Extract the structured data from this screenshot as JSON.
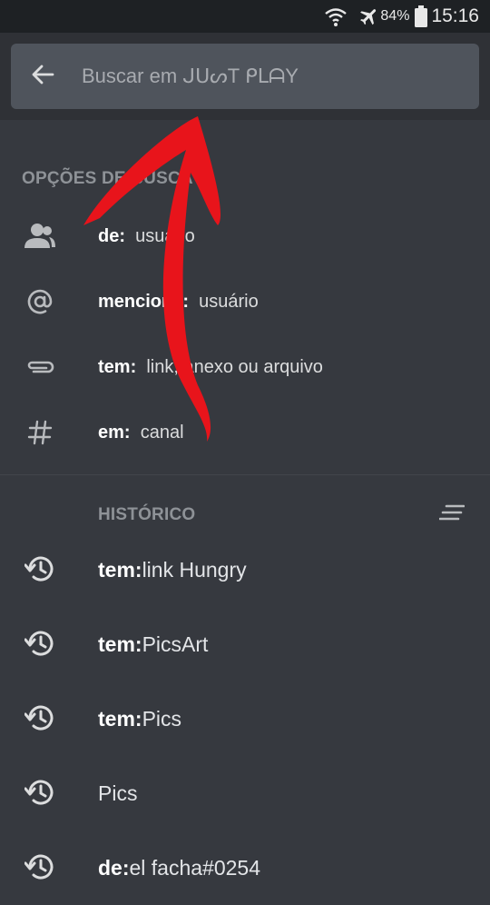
{
  "status_bar": {
    "battery": "84%",
    "time": "15:16",
    "icons": [
      "wifi-icon",
      "airplane-icon",
      "battery-icon"
    ]
  },
  "search": {
    "placeholder": "Buscar em ᒍᑌᔕT ᑭᒪᗩY",
    "back_icon": "arrow-left-icon"
  },
  "options_section": {
    "title": "OPÇÕES DE BUSCA",
    "items": [
      {
        "icon": "user-icon",
        "key": "de:",
        "value": "usuário"
      },
      {
        "icon": "at-icon",
        "key": "menciona:",
        "value": "usuário"
      },
      {
        "icon": "paperclip-icon",
        "key": "tem:",
        "value": "link, anexo ou arquivo"
      },
      {
        "icon": "hash-icon",
        "key": "em:",
        "value": "canal"
      }
    ]
  },
  "history_section": {
    "title": "HISTÓRICO",
    "clear_icon": "clear-all-icon",
    "items": [
      {
        "icon": "history-icon",
        "key": "tem:",
        "value": "link Hungry"
      },
      {
        "icon": "history-icon",
        "key": "tem:",
        "value": "PicsArt"
      },
      {
        "icon": "history-icon",
        "key": "tem:",
        "value": "Pics"
      },
      {
        "icon": "history-icon",
        "key": "",
        "value": "Pics"
      },
      {
        "icon": "history-icon",
        "key": "de:",
        "value": "el facha#0254"
      }
    ]
  },
  "colors": {
    "background": "#36393f",
    "header": "#2f3136",
    "search_box": "#4f545c",
    "annotation_arrow": "#e8141b"
  }
}
